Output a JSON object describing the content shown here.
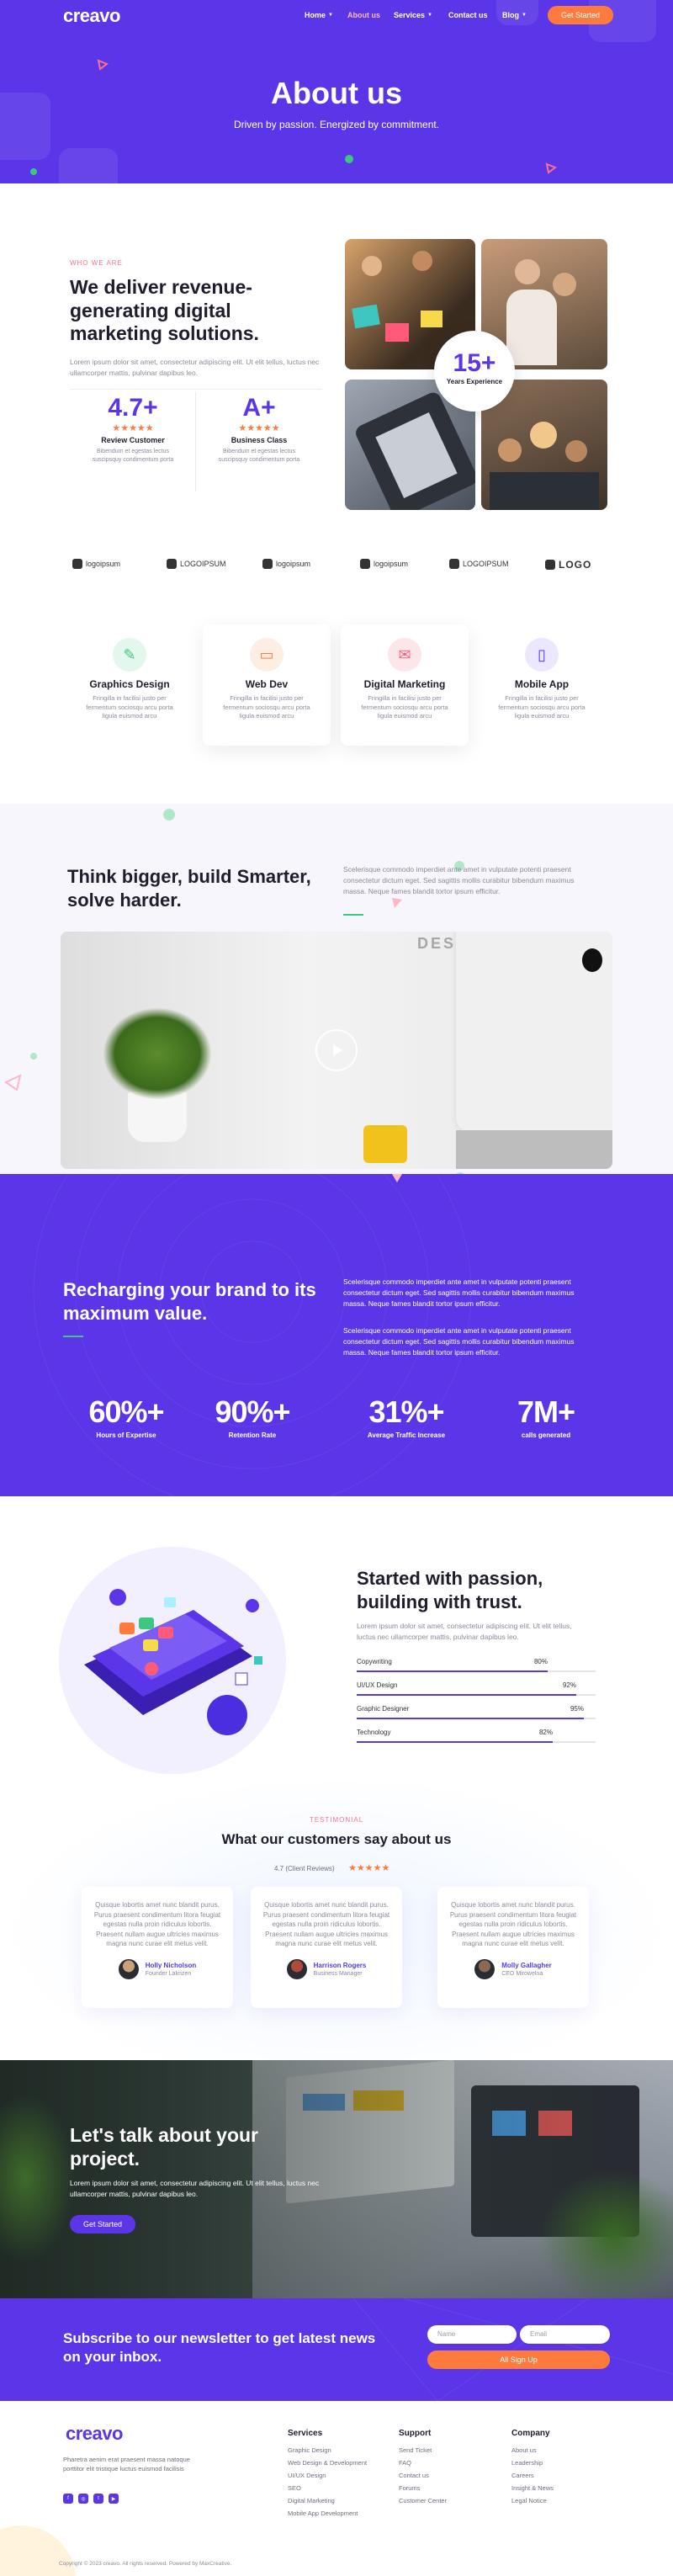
{
  "brand": {
    "logo": "creavo"
  },
  "nav": {
    "items": [
      {
        "label": "Home",
        "caret": true
      },
      {
        "label": "About us",
        "caret": false,
        "active": true
      },
      {
        "label": "Services",
        "caret": true
      },
      {
        "label": "Contact us",
        "caret": false
      },
      {
        "label": "Blog",
        "caret": true
      }
    ],
    "cta": "Get Started"
  },
  "hero": {
    "title": "About us",
    "subtitle": "Driven by passion. Energized by commitment."
  },
  "about": {
    "eyebrow": "WHO WE ARE",
    "title": "We deliver revenue-generating digital marketing solutions.",
    "text": "Lorem ipsum dolor sit amet, consectetur adipiscing elit. Ut elit tellus, luctus nec ullamcorper mattis, pulvinar dapibus leo.",
    "stats": [
      {
        "value": "4.7+",
        "label": "Review Customer",
        "text": "Bibendum et egestas lectus suscipsquy condimentum porta"
      },
      {
        "value": "A+",
        "label": "Business Class",
        "text": "Bibendum et egestas lectus suscipsquy condimentum porta"
      }
    ],
    "experience": {
      "value": "15+",
      "label": "Years Experience"
    }
  },
  "logos": [
    "logoipsum",
    "LOGOIPSUM",
    "logoipsum",
    "logoipsum",
    "LOGOIPSUM",
    "LOGO"
  ],
  "services": [
    {
      "title": "Graphics Design",
      "text": "Fringilla in facilisi justo per fermentum sociosqu arcu porta ligula euismod arcu",
      "icon": "brush-icon",
      "bg": "#e3f7ec",
      "fg": "#3ec781"
    },
    {
      "title": "Web Dev",
      "text": "Fringilla in facilisi justo per fermentum sociosqu arcu porta ligula euismod arcu",
      "icon": "monitor-icon",
      "bg": "#fdeee4",
      "fg": "#ff7b3d"
    },
    {
      "title": "Digital Marketing",
      "text": "Fringilla in facilisi justo per fermentum sociosqu arcu porta ligula euismod arcu",
      "icon": "megaphone-icon",
      "bg": "#fde6ea",
      "fg": "#ff5a7a"
    },
    {
      "title": "Mobile App",
      "text": "Fringilla in facilisi justo per fermentum sociosqu arcu porta ligula euismod arcu",
      "icon": "phone-icon",
      "bg": "#ece7fd",
      "fg": "#5a36e8"
    }
  ],
  "think": {
    "title": "Think bigger, build Smarter, solve harder.",
    "text": "Scelerisque commodo imperdiet ante amet in vulputate potenti praesent consectetur dictum eget. Sed sagittis mollis curabitur bibendum maximus massa. Neque fames blandit tortor ipsum efficitur."
  },
  "recharge": {
    "title": "Recharging your brand to its maximum value.",
    "text1": "Scelerisque commodo imperdiet ante amet in vulputate potenti praesent consectetur dictum eget. Sed sagittis mollis curabitur bibendum maximus massa. Neque fames blandit tortor ipsum efficitur.",
    "text2": "Scelerisque commodo imperdiet ante amet in vulputate potenti praesent consectetur dictum eget. Sed sagittis mollis curabitur bibendum maximus massa. Neque fames blandit tortor ipsum efficitur.",
    "stats": [
      {
        "value": "60%+",
        "label": "Hours of Expertise"
      },
      {
        "value": "90%+",
        "label": "Retention Rate"
      },
      {
        "value": "31%+",
        "label": "Average Traffic Increase"
      },
      {
        "value": "7M+",
        "label": "calls generated"
      }
    ]
  },
  "passion": {
    "title": "Started with passion, building with trust.",
    "text": "Lorem ipsum dolor sit amet, consectetur adipiscing elit. Ut elit tellus, luctus nec ullamcorper mattis, pulvinar dapibus leo.",
    "skills": [
      {
        "label": "Copywriting",
        "value": "80%",
        "level": 0.8
      },
      {
        "label": "UI/UX Design",
        "value": "92%",
        "level": 0.92
      },
      {
        "label": "Graphic Designer",
        "value": "95%",
        "level": 0.95
      },
      {
        "label": "Technology",
        "value": "82%",
        "level": 0.82
      }
    ]
  },
  "testimonials": {
    "eyebrow": "TESTIMONIAL",
    "title": "What our customers say about us",
    "rating": "4.7 (Client Reviews)",
    "stars": "★★★★★",
    "items": [
      {
        "quote": "Quisque lobortis amet nunc blandit purus. Purus praesent condimentum litora feugiat egestas nulla proin ridiculus lobortis. Praesent nullam augue ultricies maximus magna nunc curae elit metus velit.",
        "name": "Holly Nicholson",
        "role": "Founder Lakrizen",
        "avatar": "#c9a27a"
      },
      {
        "quote": "Quisque lobortis amet nunc blandit purus. Purus praesent condimentum litora feugiat egestas nulla proin ridiculus lobortis. Praesent nullam augue ultricies maximus magna nunc curae elit metus velit.",
        "name": "Harrison Rogers",
        "role": "Business Manager",
        "avatar": "#b04a3a"
      },
      {
        "quote": "Quisque lobortis amet nunc blandit purus. Purus praesent condimentum litora feugiat egestas nulla proin ridiculus lobortis. Praesent nullam augue ultricies maximus magna nunc curae elit metus velit.",
        "name": "Molly Gallagher",
        "role": "CEO Mirowelna",
        "avatar": "#8a6b52"
      }
    ]
  },
  "talk": {
    "title": "Let's talk about your project.",
    "text": "Lorem ipsum dolor sit amet, consectetur adipiscing elit. Ut elit tellus, luctus nec ullamcorper mattis, pulvinar dapibus leo.",
    "cta": "Get Started"
  },
  "newsletter": {
    "title": "Subscribe to our newsletter to get latest news on your inbox.",
    "name_placeholder": "Name",
    "email_placeholder": "Email",
    "cta": "All Sign Up"
  },
  "footer": {
    "text": "Pharetra aenim erat praesent massa natoque porttitor elit tristique luctus euismod facilisis",
    "social": [
      "f",
      "◎",
      "t",
      "▶"
    ],
    "columns": [
      {
        "title": "Services",
        "items": [
          "Graphic Design",
          "Web Design & Development",
          "UI/UX Design",
          "SEO",
          "Digital Marketing",
          "Mobile App Development"
        ]
      },
      {
        "title": "Support",
        "items": [
          "Send Ticket",
          "FAQ",
          "Contact us",
          "Forums",
          "Customer Center"
        ]
      },
      {
        "title": "Company",
        "items": [
          "About us",
          "Leadership",
          "Careers",
          "Insight & News",
          "Legal Notice"
        ]
      }
    ],
    "copyright": "Copyright © 2023 creavo. All rights reserved. Powered by MaxCreative."
  },
  "colors": {
    "primary": "#5a36e8",
    "accent": "#ff7b3d",
    "text": "#1d1d2c",
    "muted": "#8b8b98"
  }
}
